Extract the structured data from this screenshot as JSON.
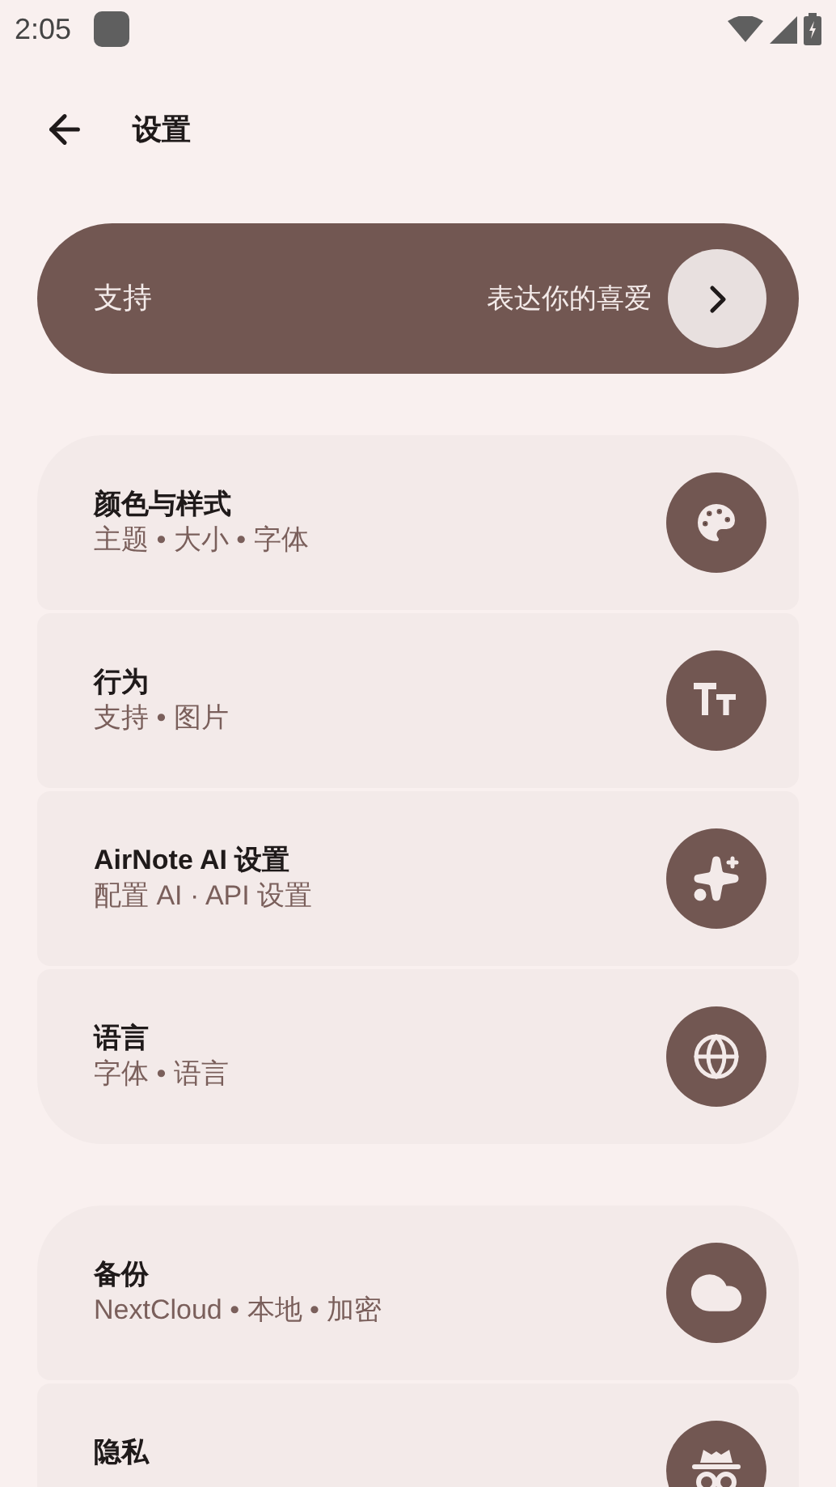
{
  "status_bar": {
    "time": "2:05"
  },
  "app_bar": {
    "title": "设置"
  },
  "support": {
    "title": "支持",
    "subtitle": "表达你的喜爱"
  },
  "groups": [
    {
      "items": [
        {
          "title": "颜色与样式",
          "subtitle": "主题 • 大小 • 字体"
        },
        {
          "title": "行为",
          "subtitle": "支持 • 图片"
        },
        {
          "title": "AirNote AI 设置",
          "subtitle": "配置 AI · API 设置"
        },
        {
          "title": "语言",
          "subtitle": "字体 • 语言"
        }
      ]
    },
    {
      "items": [
        {
          "title": "备份",
          "subtitle": "NextCloud • 本地 • 加密"
        },
        {
          "title": "隐私"
        }
      ]
    }
  ]
}
